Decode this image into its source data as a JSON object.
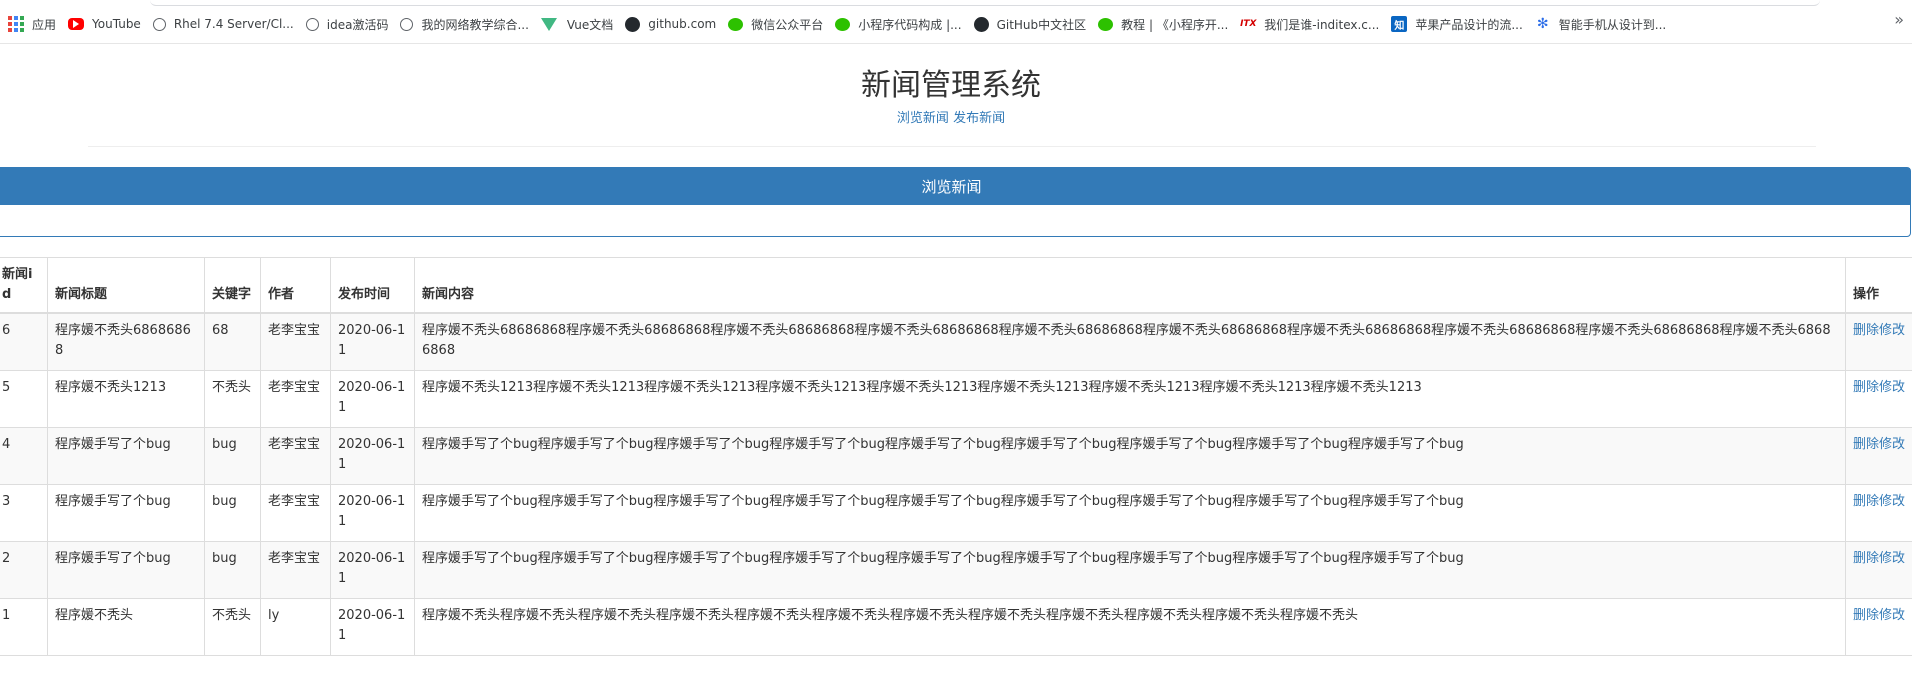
{
  "bookmarks": [
    {
      "icon": "apps-icon",
      "label": "应用"
    },
    {
      "icon": "youtube-icon",
      "label": "YouTube"
    },
    {
      "icon": "globe-icon",
      "label": "Rhel 7.4 Server/Cl..."
    },
    {
      "icon": "globe-icon",
      "label": "idea激活码"
    },
    {
      "icon": "globe-icon",
      "label": "我的网络教学综合..."
    },
    {
      "icon": "vue-icon",
      "label": "Vue文档"
    },
    {
      "icon": "github-icon",
      "label": "github.com"
    },
    {
      "icon": "wechat-icon",
      "label": "微信公众平台"
    },
    {
      "icon": "wechat-icon",
      "label": "小程序代码构成 |..."
    },
    {
      "icon": "github-icon",
      "label": "GitHub中文社区"
    },
    {
      "icon": "wechat-icon",
      "label": "教程 | 《小程序开..."
    },
    {
      "icon": "itx-icon",
      "label": "我们是谁-inditex.c..."
    },
    {
      "icon": "zhihu-icon",
      "label": "苹果产品设计的流..."
    },
    {
      "icon": "baidu-paw-icon",
      "label": "智能手机从设计到..."
    }
  ],
  "header": {
    "title": "新闻管理系统",
    "nav_browse": "浏览新闻",
    "nav_publish": "发布新闻"
  },
  "panel": {
    "heading": "浏览新闻"
  },
  "table": {
    "columns": {
      "id": "新闻id",
      "title": "新闻标题",
      "keyword": "关键字",
      "author": "作者",
      "date": "发布时间",
      "content": "新闻内容",
      "actions": "操作"
    },
    "delete_label": "删除",
    "edit_label": "修改",
    "rows": [
      {
        "id": "6",
        "title": "程序媛不秃头68686868",
        "keyword": "68",
        "author": "老李宝宝",
        "date": "2020-06-11",
        "content": "程序媛不秃头68686868程序媛不秃头68686868程序媛不秃头68686868程序媛不秃头68686868程序媛不秃头68686868程序媛不秃头68686868程序媛不秃头68686868程序媛不秃头68686868程序媛不秃头68686868程序媛不秃头68686868"
      },
      {
        "id": "5",
        "title": "程序媛不秃头1213",
        "keyword": "不秃头",
        "author": "老李宝宝",
        "date": "2020-06-11",
        "content": "程序媛不秃头1213程序媛不秃头1213程序媛不秃头1213程序媛不秃头1213程序媛不秃头1213程序媛不秃头1213程序媛不秃头1213程序媛不秃头1213程序媛不秃头1213"
      },
      {
        "id": "4",
        "title": "程序媛手写了个bug",
        "keyword": "bug",
        "author": "老李宝宝",
        "date": "2020-06-11",
        "content": "程序媛手写了个bug程序媛手写了个bug程序媛手写了个bug程序媛手写了个bug程序媛手写了个bug程序媛手写了个bug程序媛手写了个bug程序媛手写了个bug程序媛手写了个bug"
      },
      {
        "id": "3",
        "title": "程序媛手写了个bug",
        "keyword": "bug",
        "author": "老李宝宝",
        "date": "2020-06-11",
        "content": "程序媛手写了个bug程序媛手写了个bug程序媛手写了个bug程序媛手写了个bug程序媛手写了个bug程序媛手写了个bug程序媛手写了个bug程序媛手写了个bug程序媛手写了个bug"
      },
      {
        "id": "2",
        "title": "程序媛手写了个bug",
        "keyword": "bug",
        "author": "老李宝宝",
        "date": "2020-06-11",
        "content": "程序媛手写了个bug程序媛手写了个bug程序媛手写了个bug程序媛手写了个bug程序媛手写了个bug程序媛手写了个bug程序媛手写了个bug程序媛手写了个bug程序媛手写了个bug"
      },
      {
        "id": "1",
        "title": "程序媛不秃头",
        "keyword": "不秃头",
        "author": "ly",
        "date": "2020-06-11",
        "content": "程序媛不秃头程序媛不秃头程序媛不秃头程序媛不秃头程序媛不秃头程序媛不秃头程序媛不秃头程序媛不秃头程序媛不秃头程序媛不秃头程序媛不秃头程序媛不秃头"
      }
    ]
  },
  "colors": {
    "primary": "#337ab7",
    "border": "#dddddd",
    "stripe": "#f9f9f9"
  }
}
